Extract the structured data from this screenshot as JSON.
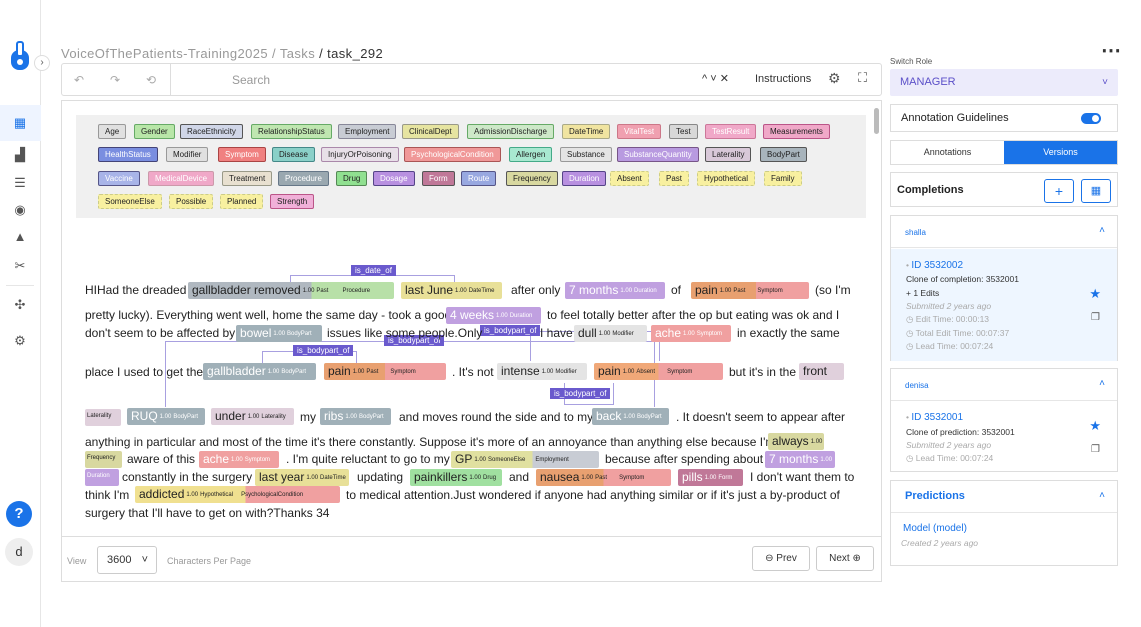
{
  "breadcrumb": {
    "project": "VoiceOfThePatients-Training2025",
    "sep1": " / ",
    "tasks": "Tasks",
    "sep2": " / ",
    "task": "task_292"
  },
  "toolbar": {
    "search_placeholder": "Search",
    "instructions": "Instructions",
    "nav_arrows": "^ ˅ ✕"
  },
  "labels": [
    "Age",
    "Gender",
    "RaceEthnicity",
    "RelationshipStatus",
    "Employment",
    "ClinicalDept",
    "AdmissionDischarge",
    "DateTime",
    "VitalTest",
    "Test",
    "TestResult",
    "Measurements",
    "HealthStatus",
    "Modifier",
    "Symptom",
    "Disease",
    "InjuryOrPoisoning",
    "PsychologicalCondition",
    "Allergen",
    "Substance",
    "SubstanceQuantity",
    "Laterality",
    "BodyPart",
    "Vaccine",
    "MedicalDevice",
    "Treatment",
    "Procedure",
    "Drug",
    "Dosage",
    "Form",
    "Route",
    "Frequency",
    "Duration",
    "Absent",
    "Past",
    "Hypothetical",
    "Family",
    "SomeoneElse",
    "Possible",
    "Planned",
    "Strength"
  ],
  "relations": {
    "r1": "is_date_of",
    "r2": "is_bodypart_of",
    "r3": "is_bodypart_of",
    "r4": "is_bodypart_of",
    "r5": "is_bodypart_of"
  },
  "text": {
    "l1a": "HIHad the dreaded",
    "l1b": "after only",
    "l1c": "of",
    "l1d": "(so I'm",
    "l2a": "pretty lucky).  Everything went well, home the same day - took a good",
    "l2b": "to feel totally better after the op but eating was ok and I",
    "l3a": "don't seem to be affected by",
    "l3b": "issues like some people.Only",
    "l3c": "I have",
    "l3d": "in exactly the same",
    "l4a": "place I used to get the",
    "l4b": ".  It's not",
    "l4c": "but it's in the",
    "l5a": "my",
    "l5b": "and moves round the side and to my",
    "l5c": ".  It doesn't seem to appear after",
    "l6a": "anything in particular and most of the time it's there constantly.  Suppose it's more of an annoyance than anything else because I'm",
    "l7a": "aware of this",
    "l7b": ".  I'm quite reluctant to go to my",
    "l7c": "because after spending about",
    "l8a": "constantly in the surgery",
    "l8b": "updating",
    "l8c": "and",
    "l8d": "I don't want them to",
    "l9a": "think I'm",
    "l9b": "to medical attention.Just wondered if anyone had anything similar or if it's just a by-product of",
    "l10a": "surgery that I'll have to get on with?Thanks 34"
  },
  "entities": {
    "e1": "gallbladder removed",
    "e1t": "Past",
    "e1t2": "Procedure",
    "e2": "last June",
    "e2t": "DateTime",
    "e3": "7 months",
    "e3t": "Duration",
    "e4": "pain",
    "e4t": "Past",
    "e4t2": "Symptom",
    "e5": "4 weeks",
    "e5t": "Duration",
    "e6": "bowel",
    "e6t": "BodyPart",
    "e7": "dull",
    "e7t": "Modifier",
    "e8": "ache",
    "e8t": "Symptom",
    "e9": "gallbladder",
    "e9t": "BodyPart",
    "e10": "pain",
    "e10t": "Past",
    "e10t2": "Symptom",
    "e11": "intense",
    "e11t": "Modifier",
    "e12": "pain",
    "e12t": "Absent",
    "e12t2": "Symptom",
    "e13": "front",
    "e13t": "Laterality",
    "e14": "RUQ",
    "e14t": "BodyPart",
    "e15": "under",
    "e15t": "Laterality",
    "e16": "ribs",
    "e16t": "BodyPart",
    "e17": "back",
    "e17t": "BodyPart",
    "e18": "always",
    "e18t": "Frequency",
    "e19": "ache",
    "e19t": "Symptom",
    "e20": "GP",
    "e20t": "SomeoneElse",
    "e20t2": "Employment",
    "e21": "7 months",
    "e21t": "Duration",
    "e22": "last year",
    "e22t": "DateTime",
    "e23": "painkillers",
    "e23t": "Drug",
    "e24": "nausea",
    "e24t": "Past",
    "e24t2": "Symptom",
    "e25": "pills",
    "e25t": "Form",
    "e26": "addicted",
    "e26t": "Hypothetical",
    "e26t2": "PsychologicalCondition",
    "score": "1.00"
  },
  "pager": {
    "view": "View",
    "per_page": "3600",
    "chars": "Characters Per Page",
    "prev": "Prev",
    "next": "Next"
  },
  "right": {
    "switch_role": "Switch Role",
    "role": "MANAGER",
    "guidelines": "Annotation Guidelines",
    "tab_annotations": "Annotations",
    "tab_versions": "Versions",
    "completions": "Completions",
    "c1": {
      "user": "shalla",
      "id": "ID 3532002",
      "clone": "Clone of completion: 3532001",
      "edits": "+ 1 Edits",
      "submitted": "Submitted 2 years ago",
      "edit": "Edit Time:  00:00:13",
      "total": "Total Edit Time:  00:07:37",
      "lead": "Lead Time:  00:07:24"
    },
    "c2": {
      "user": "denisa",
      "id": "ID 3532001",
      "clone": "Clone of prediction: 3532001",
      "submitted": "Submitted 2 years ago",
      "lead": "Lead Time:  00:07:24"
    },
    "predictions": "Predictions",
    "model": "Model (model)",
    "created": "Created 2 years ago"
  },
  "user_initial": "d"
}
